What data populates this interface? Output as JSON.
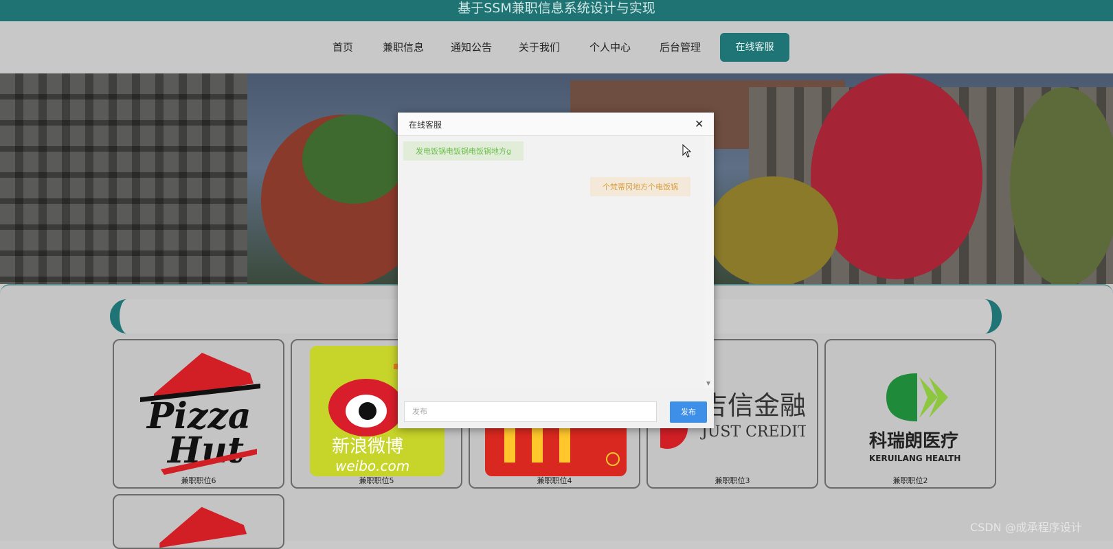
{
  "site_title": "基于SSM兼职信息系统设计与实现",
  "nav": {
    "items": [
      "首页",
      "兼职信息",
      "通知公告",
      "关于我们",
      "个人中心",
      "后台管理"
    ],
    "service_button": "在线客服"
  },
  "banner": {
    "description_icon": "campus-photo"
  },
  "jobs": [
    {
      "label": "兼职职位6",
      "logo": "pizza-hut-logo",
      "logo_text": "Pizza Hut"
    },
    {
      "label": "兼职职位5",
      "logo": "weibo-logo",
      "logo_text": "新浪微博 weibo.com"
    },
    {
      "label": "兼职职位4",
      "logo": "mcdonalds-logo",
      "logo_text": ""
    },
    {
      "label": "兼职职位3",
      "logo": "jixin-logo",
      "logo_text": "吉信金融 JUST CREDIT"
    },
    {
      "label": "兼职职位2",
      "logo": "keruilang-logo",
      "logo_text": "科瑞朗医疗 KERUILANG HEALTH"
    }
  ],
  "dialog": {
    "title": "在线客服",
    "close_icon": "close-icon",
    "messages": [
      {
        "side": "left",
        "text": "发电饭锅电饭锅电饭锅地方g"
      },
      {
        "side": "right",
        "text": "个梵蒂冈地方个电饭锅"
      }
    ],
    "input_placeholder": "发布",
    "send_label": "发布"
  },
  "watermark": "CSDN @成承程序设计",
  "colors": {
    "teal": "#1f7575",
    "send_blue": "#3d8fe8",
    "green_text": "#6abf4b",
    "orange_text": "#d9a040"
  }
}
